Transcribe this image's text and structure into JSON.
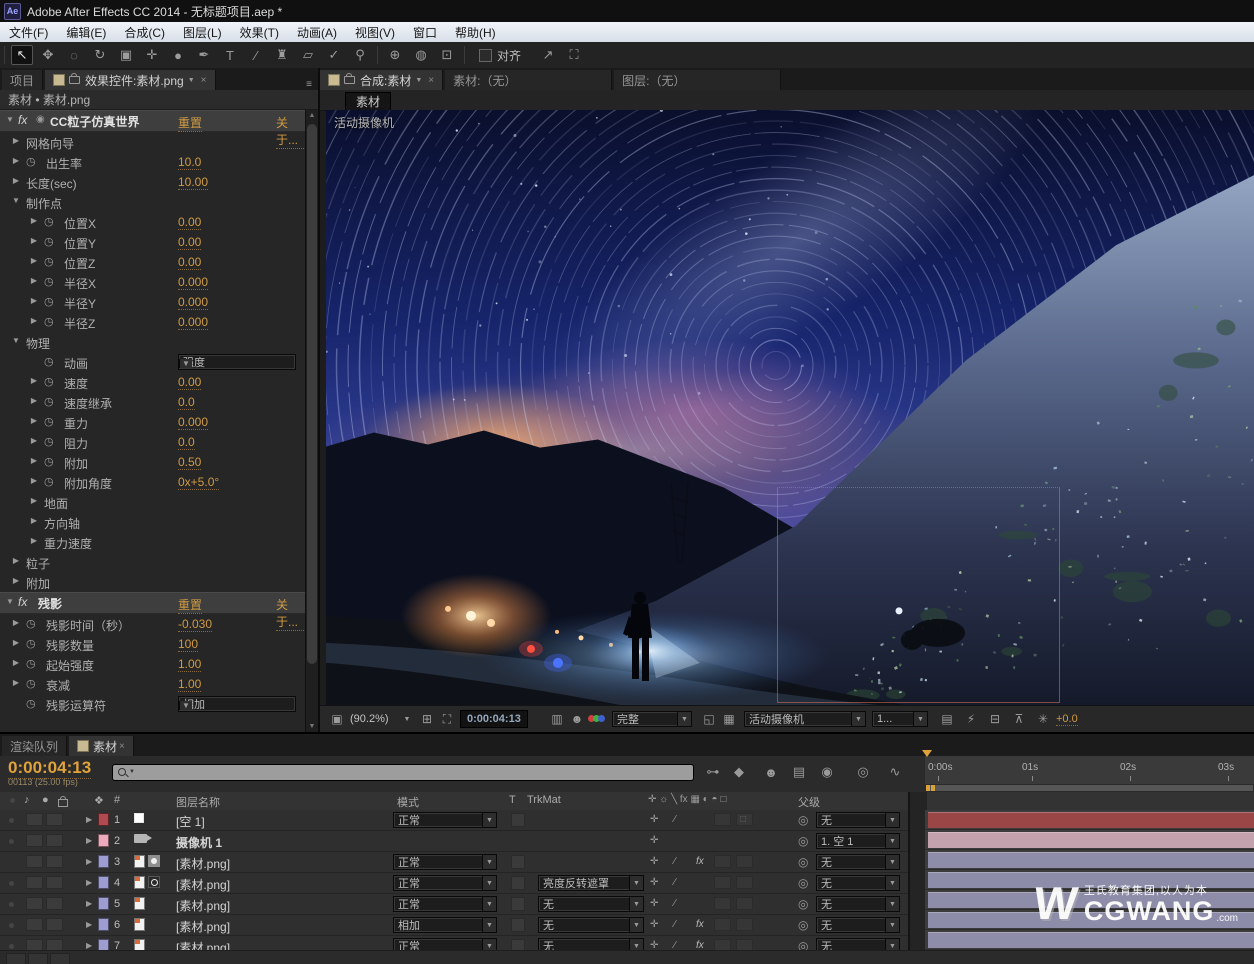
{
  "window": {
    "title": "Adobe After Effects CC 2014 - 无标题项目.aep *",
    "app_icon": "Ae"
  },
  "menu_items": [
    "文件(F)",
    "编辑(E)",
    "合成(C)",
    "图层(L)",
    "效果(T)",
    "动画(A)",
    "视图(V)",
    "窗口",
    "帮助(H)"
  ],
  "toolbar": {
    "align": "对齐",
    "tools": [
      {
        "name": "selection-tool",
        "glyph": "↖",
        "active": true
      },
      {
        "name": "hand-tool",
        "glyph": "✥"
      },
      {
        "name": "zoom-tool",
        "glyph": "◌"
      },
      {
        "name": "rotation-tool",
        "glyph": "↻"
      },
      {
        "name": "camera-tool",
        "glyph": "▣"
      },
      {
        "name": "pan-behind-tool",
        "glyph": "✛"
      },
      {
        "name": "shape-tool",
        "glyph": "●"
      },
      {
        "name": "pen-tool",
        "glyph": "✒"
      },
      {
        "name": "type-tool",
        "glyph": "T"
      },
      {
        "name": "brush-tool",
        "glyph": "∕"
      },
      {
        "name": "clone-stamp-tool",
        "glyph": "♜"
      },
      {
        "name": "eraser-tool",
        "glyph": "▱"
      },
      {
        "name": "roto-brush-tool",
        "glyph": "✓"
      },
      {
        "name": "puppet-pin-tool",
        "glyph": "⚲"
      }
    ],
    "axis_tools": [
      {
        "name": "local-axis-mode",
        "glyph": "⊕"
      },
      {
        "name": "world-axis-mode",
        "glyph": "◍"
      },
      {
        "name": "view-axis-mode",
        "glyph": "⊡"
      }
    ],
    "right_tools": [
      {
        "name": "zoom-arrow-tool",
        "glyph": "↗"
      },
      {
        "name": "workspace-bracket-tool",
        "glyph": "⛶"
      }
    ]
  },
  "icons": {
    "fx": "fx",
    "stopwatch": "◷",
    "down": "▼",
    "right": "▶",
    "pickwhip": "◎",
    "caret": "▼",
    "close": "×",
    "panel_menu": "≡"
  },
  "effect_controls": {
    "project_tab": "项目",
    "tab": "效果控件:素材.png",
    "breadcrumb": "素材 • 素材.png",
    "rows": [
      {
        "t": "fx",
        "label": "CC粒子仿真世界",
        "reset": "重置",
        "about": "关于...",
        "icon": true
      },
      {
        "t": "g",
        "i": 1,
        "arrow": "r",
        "label": "网格向导"
      },
      {
        "t": "p",
        "i": 1,
        "arrow": "r",
        "sw": true,
        "label": "出生率",
        "value": "10.0"
      },
      {
        "t": "p",
        "i": 1,
        "arrow": "r",
        "label": "长度(sec)",
        "value": "10.00"
      },
      {
        "t": "g",
        "i": 1,
        "arrow": "d",
        "label": "制作点"
      },
      {
        "t": "p",
        "i": 2,
        "arrow": "r",
        "sw": true,
        "label": "位置X",
        "value": "0.00"
      },
      {
        "t": "p",
        "i": 2,
        "arrow": "r",
        "sw": true,
        "label": "位置Y",
        "value": "0.00"
      },
      {
        "t": "p",
        "i": 2,
        "arrow": "r",
        "sw": true,
        "label": "位置Z",
        "value": "0.00"
      },
      {
        "t": "p",
        "i": 2,
        "arrow": "r",
        "sw": true,
        "label": "半径X",
        "value": "0.000"
      },
      {
        "t": "p",
        "i": 2,
        "arrow": "r",
        "sw": true,
        "label": "半径Y",
        "value": "0.000"
      },
      {
        "t": "p",
        "i": 2,
        "arrow": "r",
        "sw": true,
        "label": "半径Z",
        "value": "0.000"
      },
      {
        "t": "g",
        "i": 1,
        "arrow": "d",
        "label": "物理"
      },
      {
        "t": "p",
        "i": 2,
        "sw": true,
        "label": "动画",
        "dropdown": "强度"
      },
      {
        "t": "p",
        "i": 2,
        "arrow": "r",
        "sw": true,
        "label": "速度",
        "value": "0.00"
      },
      {
        "t": "p",
        "i": 2,
        "arrow": "r",
        "sw": true,
        "label": "速度继承",
        "value": "0.0"
      },
      {
        "t": "p",
        "i": 2,
        "arrow": "r",
        "sw": true,
        "label": "重力",
        "value": "0.000"
      },
      {
        "t": "p",
        "i": 2,
        "arrow": "r",
        "sw": true,
        "label": "阻力",
        "value": "0.0"
      },
      {
        "t": "p",
        "i": 2,
        "arrow": "r",
        "sw": true,
        "label": "附加",
        "value": "0.50"
      },
      {
        "t": "p",
        "i": 2,
        "arrow": "r",
        "sw": true,
        "label": "附加角度",
        "value": "0x+5.0°"
      },
      {
        "t": "g",
        "i": 2,
        "arrow": "r",
        "label": "地面"
      },
      {
        "t": "g",
        "i": 2,
        "arrow": "r",
        "label": "方向轴"
      },
      {
        "t": "g",
        "i": 2,
        "arrow": "r",
        "label": "重力速度"
      },
      {
        "t": "g",
        "i": 1,
        "arrow": "r",
        "label": "粒子"
      },
      {
        "t": "g",
        "i": 1,
        "arrow": "r",
        "label": "附加"
      },
      {
        "t": "fx",
        "label": "残影",
        "reset": "重置",
        "about": "关于...",
        "icon": false
      },
      {
        "t": "p",
        "i": 1,
        "arrow": "r",
        "sw": true,
        "label": "残影时间（秒）",
        "value": "-0.030"
      },
      {
        "t": "p",
        "i": 1,
        "arrow": "r",
        "sw": true,
        "label": "残影数量",
        "value": "100"
      },
      {
        "t": "p",
        "i": 1,
        "arrow": "r",
        "sw": true,
        "label": "起始强度",
        "value": "1.00"
      },
      {
        "t": "p",
        "i": 1,
        "arrow": "r",
        "sw": true,
        "label": "衰减",
        "value": "1.00"
      },
      {
        "t": "p",
        "i": 1,
        "sw": true,
        "label": "残影运算符",
        "dropdown": "相加"
      }
    ]
  },
  "viewer": {
    "tabs": [
      {
        "label": "合成:素材",
        "active": true
      },
      {
        "label": "素材:（无）",
        "active": false
      },
      {
        "label": "图层:（无）",
        "active": false
      }
    ],
    "comp_tab": "素材",
    "overlay": "活动摄像机",
    "status": {
      "zoom": "(90.2%)",
      "timecode": "0:00:04:13",
      "resolution": "完整",
      "view": "活动摄像机",
      "layout": "1...",
      "exposure": "+0.0"
    }
  },
  "timeline": {
    "tabs": [
      {
        "label": "渲染队列",
        "active": false
      },
      {
        "label": "素材",
        "active": true
      }
    ],
    "timecode": "0:00:04:13",
    "frames": "00113 (25.00 fps)",
    "headers": {
      "num": "#",
      "name": "图层名称",
      "mode": "模式",
      "t": "T",
      "trkmat": "TrkMat",
      "parent": "父级"
    },
    "ruler": [
      "0:00s",
      "01s",
      "02s",
      "03s"
    ],
    "layers": [
      {
        "n": 1,
        "eye": true,
        "color": "#b04a50",
        "icon": "null",
        "name": "[空 1]",
        "mode": "正常",
        "trk": null,
        "sw": [
          "collapse",
          "quality",
          "",
          "cube"
        ],
        "parent": "无",
        "bar": "#9a4646"
      },
      {
        "n": 2,
        "eye": true,
        "color": "#ecaabc",
        "icon": "camera",
        "name": "摄像机 1",
        "mode": null,
        "trk": null,
        "sw": [
          "collapse"
        ],
        "parent": "1. 空 1",
        "bar": "#c4a2ad"
      },
      {
        "n": 3,
        "eye": false,
        "color": "#9d9dd1",
        "icon": "png2",
        "name": "[素材.png]",
        "mode": "正常",
        "trk": null,
        "sw": [
          "collapse",
          "quality",
          "fx"
        ],
        "parent": "无",
        "bar": "#8d8da9"
      },
      {
        "n": 4,
        "eye": true,
        "color": "#9d9dd1",
        "icon": "png3",
        "name": "[素材.png]",
        "mode": "正常",
        "trk": "亮度反转遮罩",
        "sw": [
          "collapse",
          "quality"
        ],
        "parent": "无",
        "bar": "#8d8da9"
      },
      {
        "n": 5,
        "eye": true,
        "color": "#9d9dd1",
        "icon": "png",
        "name": "[素材.png]",
        "mode": "正常",
        "trk": "无",
        "sw": [
          "collapse",
          "quality"
        ],
        "parent": "无",
        "bar": "#8d8da9"
      },
      {
        "n": 6,
        "eye": true,
        "color": "#9d9dd1",
        "icon": "png",
        "name": "[素材.png]",
        "mode": "相加",
        "trk": "无",
        "sw": [
          "collapse",
          "quality",
          "fx"
        ],
        "parent": "无",
        "bar": "#8d8da9"
      },
      {
        "n": 7,
        "eye": true,
        "color": "#9d9dd1",
        "icon": "png",
        "name": "[素材.png]",
        "mode": "正常",
        "trk": "无",
        "sw": [
          "collapse",
          "quality",
          "fx"
        ],
        "parent": "无",
        "bar": "#8d8da9"
      }
    ],
    "tl_icons": [
      {
        "name": "comp-mini-flowchart-icon",
        "glyph": "⊶"
      },
      {
        "name": "draft-3d-icon",
        "glyph": "◆"
      },
      {
        "name": "hide-shy-layers-icon",
        "glyph": "☻"
      },
      {
        "name": "frame-blending-icon",
        "glyph": "▤"
      },
      {
        "name": "motion-blur-icon",
        "glyph": "◉"
      },
      {
        "name": "brainstorm-icon",
        "glyph": "◎"
      },
      {
        "name": "graph-editor-icon",
        "glyph": "∿"
      }
    ],
    "watermark": {
      "logo": "W",
      "top": "王氏教育集团,以人为本",
      "brand": "CGWANG",
      "suffix": ".com"
    }
  },
  "colors": {
    "accent_orange": "#cf9a43",
    "timecode_orange": "#e0a33c",
    "panel_bg": "#262626",
    "value_underline": "#8a6a30"
  }
}
